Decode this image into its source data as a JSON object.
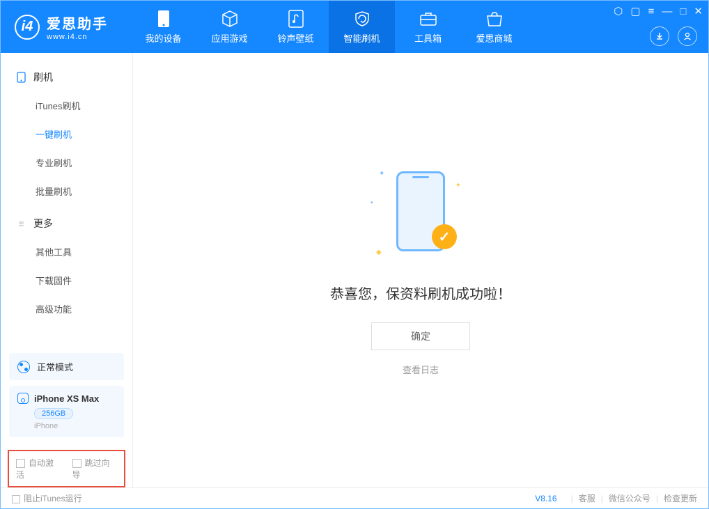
{
  "app": {
    "name": "爱思助手",
    "url": "www.i4.cn"
  },
  "nav": {
    "items": [
      {
        "label": "我的设备",
        "icon": "phone-icon"
      },
      {
        "label": "应用游戏",
        "icon": "cube-icon"
      },
      {
        "label": "铃声壁纸",
        "icon": "music-file-icon"
      },
      {
        "label": "智能刷机",
        "icon": "refresh-shield-icon",
        "active": true
      },
      {
        "label": "工具箱",
        "icon": "toolbox-icon"
      },
      {
        "label": "爱思商城",
        "icon": "store-icon"
      }
    ]
  },
  "sidebar": {
    "sections": [
      {
        "title": "刷机",
        "icon": "device-icon",
        "items": [
          {
            "label": "iTunes刷机"
          },
          {
            "label": "一键刷机",
            "active": true
          },
          {
            "label": "专业刷机"
          },
          {
            "label": "批量刷机"
          }
        ]
      },
      {
        "title": "更多",
        "icon": "menu-icon",
        "items": [
          {
            "label": "其他工具"
          },
          {
            "label": "下载固件"
          },
          {
            "label": "高级功能"
          }
        ]
      }
    ]
  },
  "mode": {
    "label": "正常模式"
  },
  "device": {
    "name": "iPhone XS Max",
    "storage": "256GB",
    "type": "iPhone"
  },
  "checkboxes": {
    "auto_activate": "自动激活",
    "skip_guide": "跳过向导"
  },
  "main": {
    "success_title": "恭喜您，保资料刷机成功啦！",
    "ok_button": "确定",
    "view_log": "查看日志"
  },
  "footer": {
    "block_itunes": "阻止iTunes运行",
    "version": "V8.16",
    "links": [
      "客服",
      "微信公众号",
      "检查更新"
    ]
  }
}
